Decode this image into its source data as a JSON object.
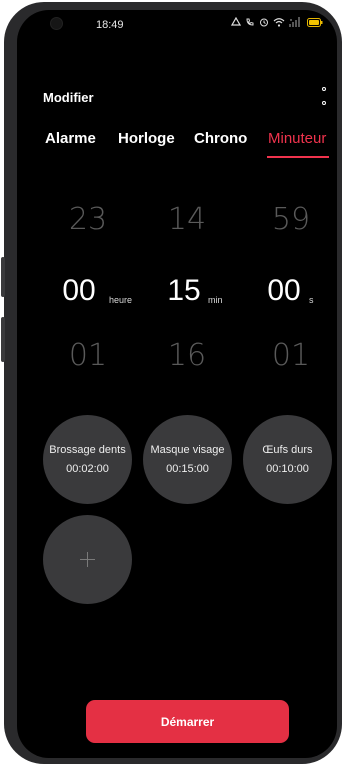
{
  "status_bar": {
    "time": "18:49"
  },
  "header": {
    "title": "Modifier"
  },
  "tabs": [
    {
      "label": "Alarme",
      "active": false
    },
    {
      "label": "Horloge",
      "active": false
    },
    {
      "label": "Chrono",
      "active": false
    },
    {
      "label": "Minuteur",
      "active": true
    }
  ],
  "picker": {
    "hours": {
      "prev": "23",
      "current": "00",
      "next": "01",
      "unit": "heure"
    },
    "minutes": {
      "prev": "14",
      "current": "15",
      "next": "16",
      "unit": "min"
    },
    "seconds": {
      "prev": "59",
      "current": "00",
      "next": "01",
      "unit": "s"
    }
  },
  "presets": [
    {
      "name": "Brossage dents",
      "time": "00:02:00"
    },
    {
      "name": "Masque visage",
      "time": "00:15:00"
    },
    {
      "name": "Œufs durs",
      "time": "00:10:00"
    }
  ],
  "add_preset": {
    "symbol": "+"
  },
  "start_button": {
    "label": "Démarrer"
  },
  "colors": {
    "accent": "#f0334d",
    "button": "#e43044",
    "circle": "#3a3a3c",
    "background": "#000000"
  }
}
